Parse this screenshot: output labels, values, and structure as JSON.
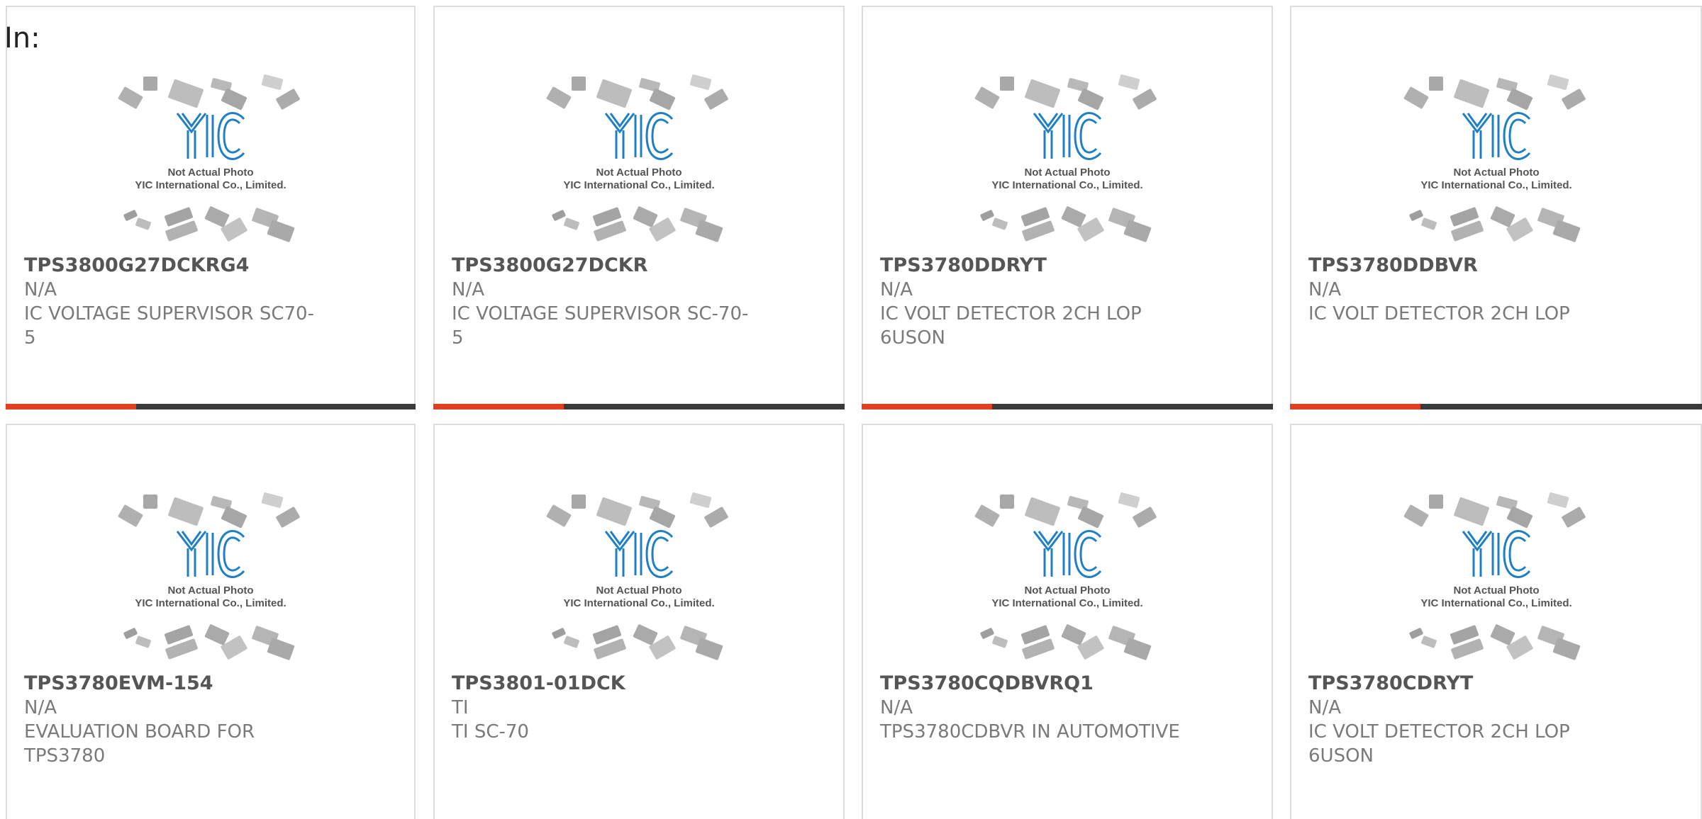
{
  "filter": {
    "label": "In:"
  },
  "photo_caption": {
    "line1": "Not Actual Photo",
    "line2": "YIC International Co., Limited.",
    "logo_text": "YIC"
  },
  "colors": {
    "accent": "#e0401f",
    "bar": "#3a3a3a",
    "logo_blue": "#1f7fc4",
    "border": "#dcdcdc"
  },
  "products": [
    {
      "part_number": "TPS3800G27DCKRG4",
      "manufacturer": "N/A",
      "description": "IC VOLTAGE SUPERVISOR SC70-5"
    },
    {
      "part_number": "TPS3800G27DCKR",
      "manufacturer": "N/A",
      "description": "IC VOLTAGE SUPERVISOR SC-70-5"
    },
    {
      "part_number": "TPS3780DDRYT",
      "manufacturer": "N/A",
      "description": "IC VOLT DETECTOR 2CH LOP 6USON"
    },
    {
      "part_number": "TPS3780DDBVR",
      "manufacturer": "N/A",
      "description": "IC VOLT DETECTOR 2CH LOP"
    },
    {
      "part_number": "TPS3780EVM-154",
      "manufacturer": "N/A",
      "description": "EVALUATION BOARD FOR TPS3780"
    },
    {
      "part_number": "TPS3801-01DCK",
      "manufacturer": "TI",
      "description": "TI SC-70"
    },
    {
      "part_number": "TPS3780CQDBVRQ1",
      "manufacturer": "N/A",
      "description": "TPS3780CDBVR IN AUTOMOTIVE"
    },
    {
      "part_number": "TPS3780CDRYT",
      "manufacturer": "N/A",
      "description": "IC VOLT DETECTOR 2CH LOP 6USON"
    }
  ]
}
